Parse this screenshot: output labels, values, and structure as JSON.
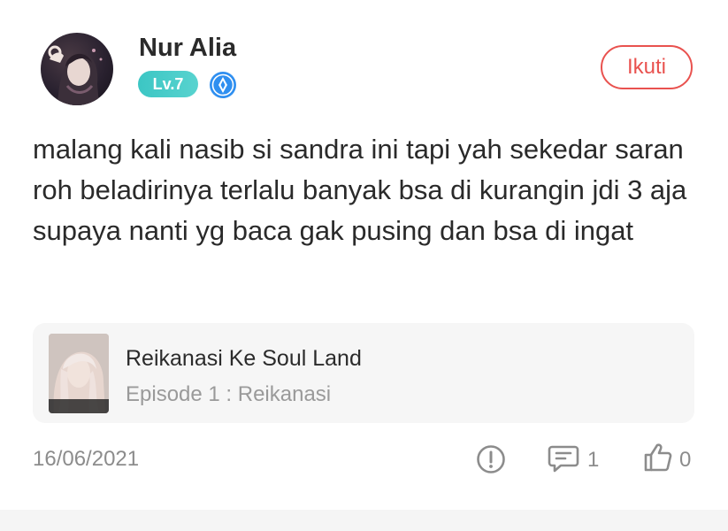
{
  "post": {
    "author": {
      "name": "Nur Alia",
      "level": "Lv.7",
      "avatar_icon": "avatar-portrait",
      "verify_icon": "verified-badge-icon"
    },
    "follow_label": "Ikuti",
    "text": "malang kali nasib si sandra ini tapi yah sekedar saran roh beladirinya terlalu banyak bsa di kurangin jdi 3 aja supaya nanti yg baca gak pusing dan bsa di ingat",
    "book": {
      "title": "Reikanasi Ke Soul Land",
      "episode": "Episode 1 : Reikanasi"
    },
    "date": "16/06/2021",
    "actions": {
      "report_icon": "report-icon",
      "comment_icon": "comment-icon",
      "comment_count": "1",
      "like_icon": "thumbs-up-icon",
      "like_count": "0"
    }
  },
  "colors": {
    "accent": "#e9524f",
    "level_badge": "#3cc6c4",
    "verify_badge": "#2f8ff0",
    "muted_text": "#8c8c8c",
    "card_bg": "#f6f6f6"
  }
}
